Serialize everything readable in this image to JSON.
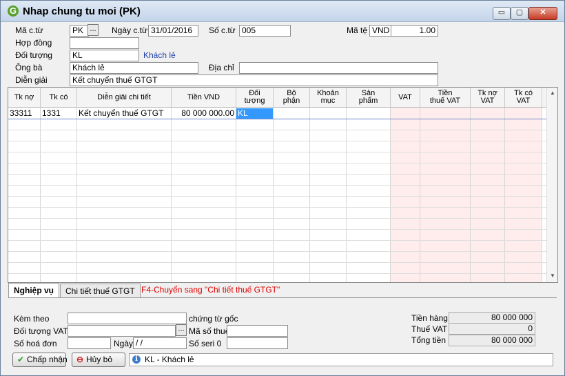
{
  "window": {
    "title": "Nhap chung tu moi (PK)",
    "min_glyph": "▭",
    "max_glyph": "▢",
    "close_glyph": "✕"
  },
  "header": {
    "ma_ctu_label": "Mã c.từ",
    "ma_ctu_value": "PK",
    "ma_ctu_button": "...",
    "ngay_ctu_label": "Ngày c.từ",
    "ngay_ctu_value": "31/01/2016",
    "so_ctu_label": "Số c.từ",
    "so_ctu_value": "005",
    "ma_te_label": "Mã tệ",
    "ma_te_value": "VND",
    "ty_gia_value": "1.00",
    "hop_dong_label": "Hợp đồng",
    "hop_dong_value": "",
    "doi_tuong_label": "Đối tượng",
    "doi_tuong_value": "KL",
    "doi_tuong_name": "Khách lẻ",
    "ong_ba_label": "Ông bà",
    "ong_ba_value": "Khách lẻ",
    "dia_chi_label": "Địa chỉ",
    "dia_chi_value": "",
    "dien_giai_label": "Diễn giải",
    "dien_giai_value": "Kết chuyển thuế GTGT"
  },
  "grid": {
    "columns": [
      "Tk nợ",
      "Tk có",
      "Diễn giải chi tiết",
      "Tiền VND",
      "Đối\ntượng",
      "Bộ\nphận",
      "Khoản\nmục",
      "Sản\nphẩm",
      "VAT",
      "Tiền\nthuế VAT",
      "Tk nợ\nVAT",
      "Tk có\nVAT"
    ],
    "rows": [
      {
        "tk_no": "33311",
        "tk_co": "1331",
        "dien_giai": "Kết chuyển thuế GTGT",
        "tien_vnd": "80 000 000.00",
        "doi_tuong": "KL"
      }
    ],
    "scroll_up": "▲",
    "scroll_down": "▼"
  },
  "tabs": {
    "nghiep_vu": "Nghiệp vụ",
    "chi_tiet": "Chi tiết thuế GTGT",
    "hint": "F4-Chuyển sang \"Chi tiết thuế GTGT\""
  },
  "footer": {
    "kem_theo_label": "Kèm theo",
    "kem_theo_value": "",
    "chung_tu_goc_label": "chứng từ gốc",
    "doi_tuong_vat_label": "Đối tượng VAT",
    "doi_tuong_vat_value": "",
    "doi_tuong_vat_button": "...",
    "ma_so_thue_label": "Mã số thuế",
    "ma_so_thue_value": "",
    "so_hoa_don_label": "Số hoá đơn",
    "so_hoa_don_value": "",
    "ngay_label": "Ngày",
    "ngay_value": " /  /",
    "so_seri_label": "Số seri 0",
    "so_seri_value": "",
    "tien_hang_label": "Tiền hàng",
    "tien_hang_value": "80 000 000",
    "thue_vat_label": "Thuế VAT",
    "thue_vat_value": "0",
    "tong_tien_label": "Tổng tiền",
    "tong_tien_value": "80 000 000"
  },
  "buttons": {
    "chap_nhan": "Chấp nhận",
    "huy_bo": "Hủy bỏ",
    "chap_nhan_icon": "✔",
    "huy_bo_icon": "⊖"
  },
  "status": {
    "icon": "i",
    "text": "KL - Khách lẻ"
  },
  "colors": {
    "vat_column_bg": "#ffecec",
    "selection": "#3399ff",
    "hint_red": "#e00000",
    "link_blue": "#1f3fa8"
  }
}
